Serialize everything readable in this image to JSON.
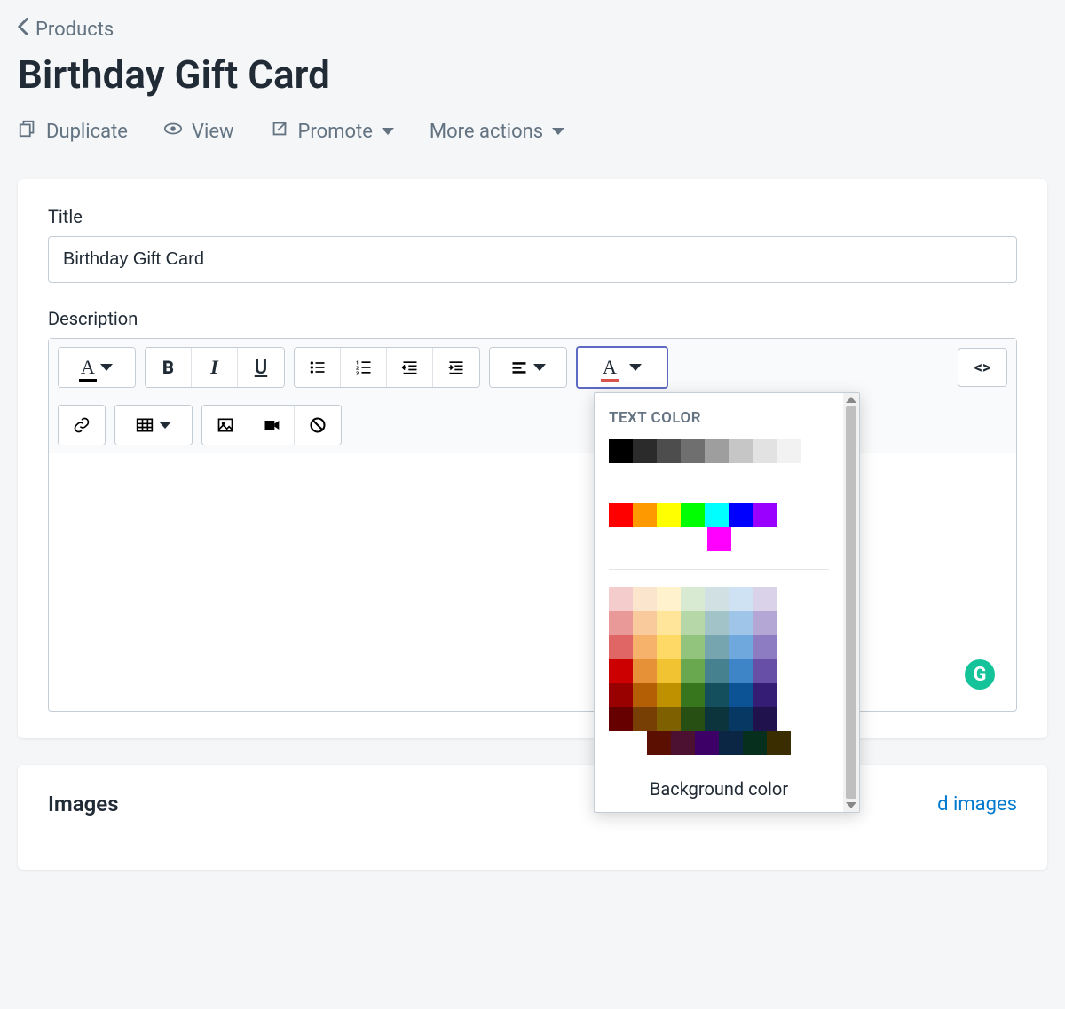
{
  "breadcrumb": {
    "back_label": "Products"
  },
  "page": {
    "title": "Birthday Gift Card"
  },
  "actions": {
    "duplicate": "Duplicate",
    "view": "View",
    "promote": "Promote",
    "more": "More actions"
  },
  "form": {
    "title_label": "Title",
    "title_value": "Birthday Gift Card",
    "description_label": "Description"
  },
  "rte": {
    "code_toggle": "<>"
  },
  "color_popover": {
    "title": "TEXT COLOR",
    "bg_label": "Background color",
    "grays": [
      "#000000",
      "#2b2b2b",
      "#4d4d4d",
      "#6f6f6f",
      "#9e9e9e",
      "#c6c6c6",
      "#e2e2e2",
      "#f2f2f2"
    ],
    "mains": [
      "#ff0000",
      "#ff9900",
      "#ffff00",
      "#00ff00",
      "#00ffff",
      "#0000ff",
      "#9900ff"
    ],
    "mains_extra": [
      "#ff00ff"
    ],
    "palette": [
      "#f4cccc",
      "#fce5cd",
      "#fff2cc",
      "#d9ead3",
      "#d0e0e3",
      "#cfe2f3",
      "#d9d2e9",
      "#ea9999",
      "#f9cb9c",
      "#ffe599",
      "#b6d7a8",
      "#a2c4c9",
      "#9fc5e8",
      "#b4a7d6",
      "#e06666",
      "#f6b26b",
      "#ffd966",
      "#93c47d",
      "#76a5af",
      "#6fa8dc",
      "#8e7cc3",
      "#cc0000",
      "#e69138",
      "#f1c232",
      "#6aa84f",
      "#45818e",
      "#3d85c6",
      "#674ea7",
      "#990000",
      "#b45f06",
      "#bf9000",
      "#38761d",
      "#134f5c",
      "#0b5394",
      "#351c75",
      "#660000",
      "#783f04",
      "#7f6000",
      "#274e13",
      "#0c343d",
      "#073763",
      "#20124d"
    ],
    "palette2": [
      "#5b0f00",
      "#4c1130",
      "#3d0066",
      "#0b2545",
      "#072f1e",
      "#3a2e00"
    ]
  },
  "images_section": {
    "title": "Images",
    "link": "d images"
  },
  "grammarly_glyph": "G"
}
